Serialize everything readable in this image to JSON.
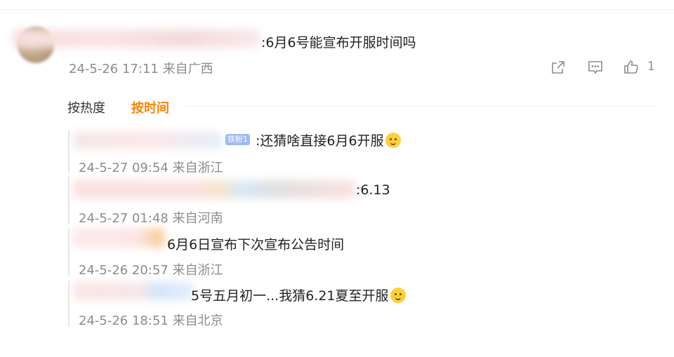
{
  "comment": {
    "text": ":6月6号能宣布开服时间吗",
    "time": "24-5-26 17:11 来自广西",
    "likes": "1",
    "icons": [
      "share-icon",
      "comment-icon",
      "like-icon"
    ]
  },
  "sort": {
    "hot_label": "按热度",
    "time_label": "按时间",
    "active_color": "#ff8200"
  },
  "replies": [
    {
      "badge": "铁粉1",
      "text": ":还猜啥直接6月6开服",
      "time": "24-5-27 09:54 来自浙江",
      "emoji": "doge-emoji-icon"
    },
    {
      "text": ":6.13",
      "time": "24-5-27 01:48 来自河南"
    },
    {
      "text": "6月6日宣布下次宣布公告时间",
      "time": "24-5-26 20:57 来自浙江"
    },
    {
      "text": "5号五月初一...我猜6.21夏至开服",
      "time": "24-5-26 18:51 来自北京",
      "emoji": "laugh-emoji-icon"
    }
  ]
}
